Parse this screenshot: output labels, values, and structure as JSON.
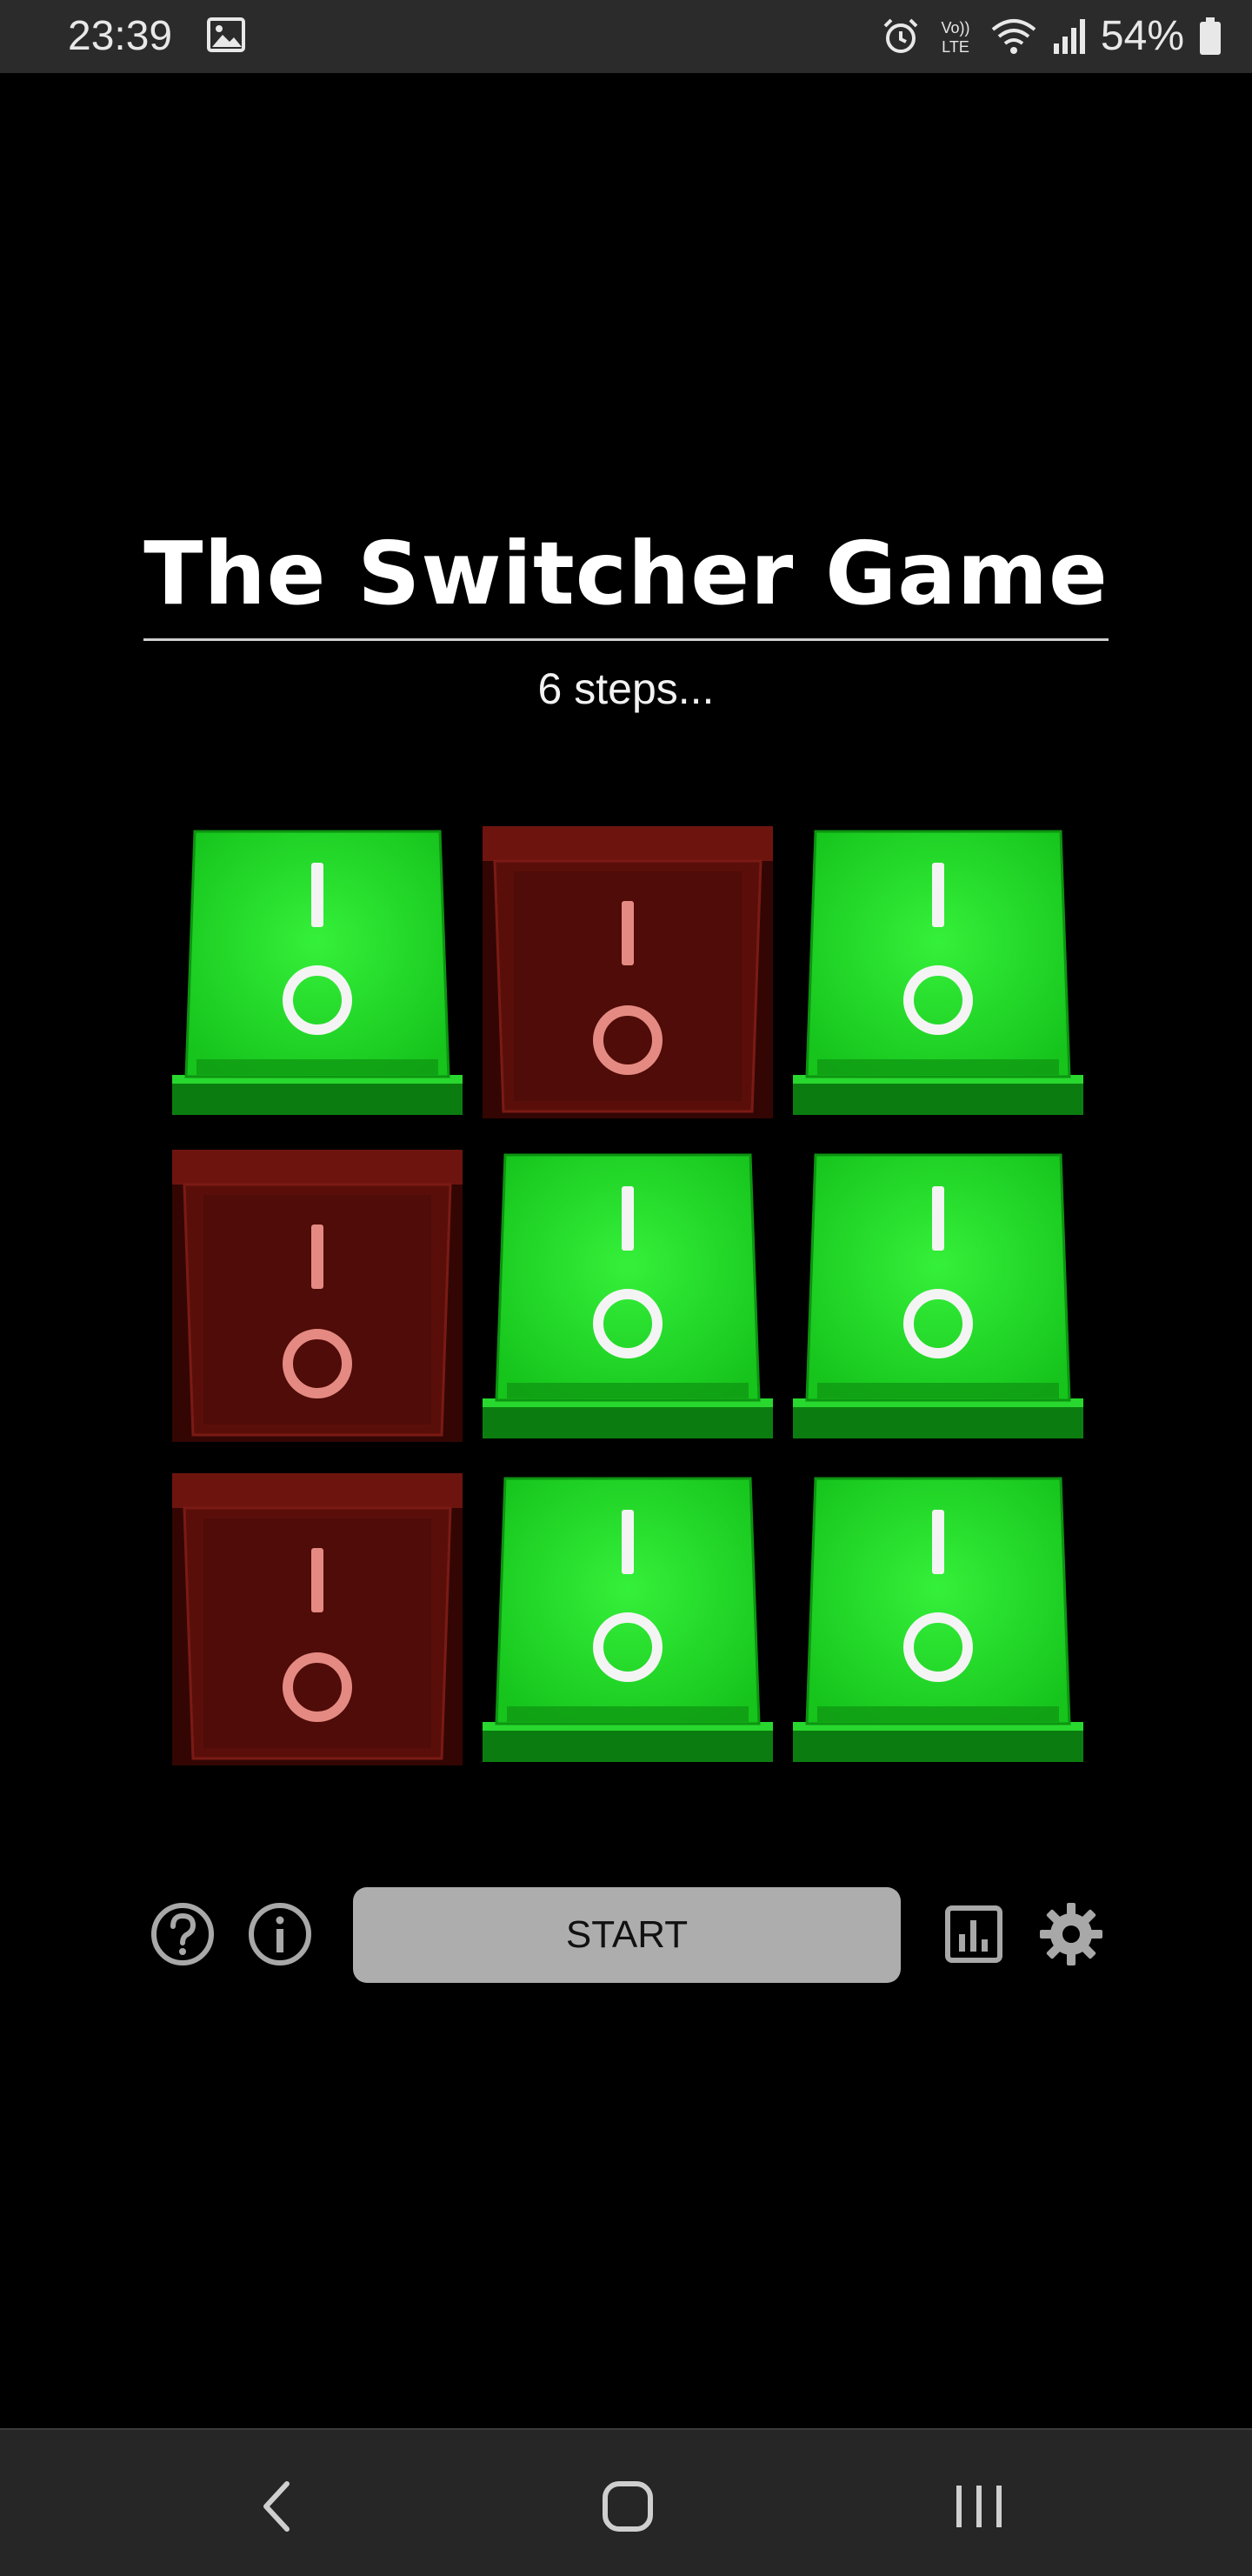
{
  "status_bar": {
    "time": "23:39",
    "battery": "54%",
    "icons": [
      "gallery-icon",
      "alarm-icon",
      "volte-icon",
      "wifi-icon",
      "signal-icon",
      "battery-icon"
    ],
    "volte_top": "Vo))",
    "volte_bottom": "LTE"
  },
  "game": {
    "title": "The Switcher Game",
    "steps": "6 steps...",
    "switch_grid": [
      [
        "on",
        "off",
        "on"
      ],
      [
        "off",
        "on",
        "on"
      ],
      [
        "off",
        "on",
        "on"
      ]
    ],
    "colors": {
      "on": "#16c41c",
      "on_dark": "#0b7d10",
      "off": "#5a0e0a",
      "off_dark": "#330604",
      "on_symbol": "#f4f4f4",
      "off_symbol": "#e58a82"
    }
  },
  "controls": {
    "start_label": "START",
    "icons": [
      "help-icon",
      "info-icon",
      "stats-icon",
      "settings-icon"
    ]
  },
  "nav_bar": {
    "icons": [
      "back-icon",
      "home-icon",
      "recents-icon"
    ]
  }
}
